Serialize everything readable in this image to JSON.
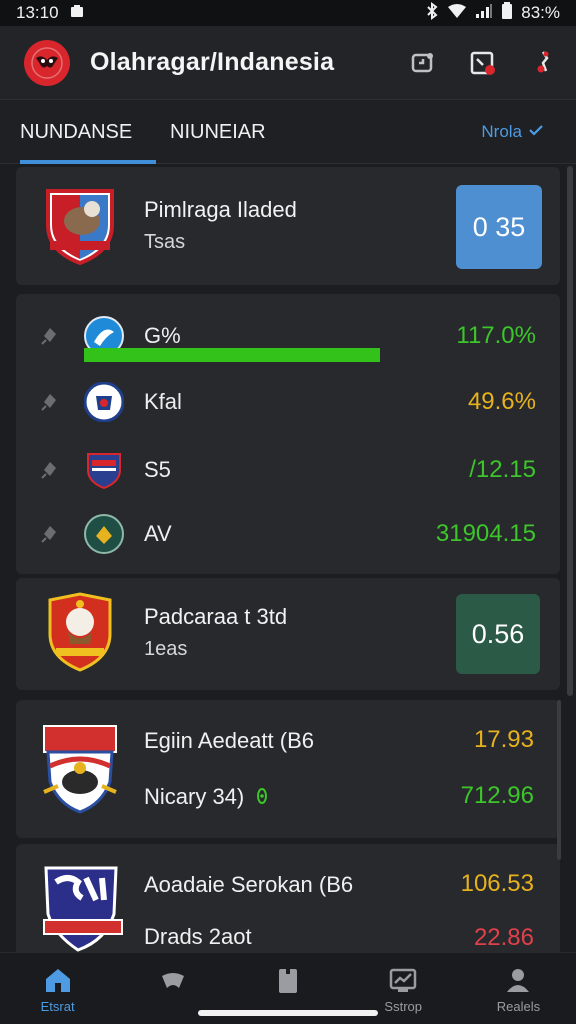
{
  "status_bar": {
    "time": "13:10",
    "battery": "83:%"
  },
  "app": {
    "title": "Olahragar/Indanesia"
  },
  "tabs": {
    "active": "NUNDANSE",
    "second": "NIUNEIAR",
    "filter_label": "Nrola"
  },
  "team_cards": [
    {
      "name": "Pimlraga Iladed",
      "sub": "Tsas",
      "score": "0 35",
      "score_color": "#4e8fd1"
    },
    {
      "name": "Padcaraa t 3td",
      "sub": "1eas",
      "score": "0.56",
      "score_color": "#2b5a46"
    }
  ],
  "stats": {
    "rows": [
      {
        "label": "G%",
        "value": "117.0%",
        "value_color": "#3cc62a",
        "progress": 1.0
      },
      {
        "label": "Kfal",
        "value": "49.6%",
        "value_color": "#e6b21e"
      },
      {
        "label": "S5",
        "value": "/12.15",
        "value_color": "#3cc62a"
      },
      {
        "label": "AV",
        "value": "31904.15",
        "value_color": "#3cc62a"
      }
    ]
  },
  "matches": [
    {
      "name": "Egiin Aedeatt (B6",
      "value": "17.93",
      "value_color": "#e6b21e",
      "sub_name": "Nicary 34)",
      "sub_value": "712.96",
      "sub_value_color": "#3cc62a"
    },
    {
      "name": "Aoadaie Serokan (B6",
      "value": "106.53",
      "value_color": "#e6b21e",
      "sub_name": "Drads 2aot",
      "sub_value": "22.86",
      "sub_value_color": "#e0404a"
    }
  ],
  "bottom_nav": [
    {
      "label": "Etsrat",
      "icon": "home-icon",
      "active": true
    },
    {
      "label": "",
      "icon": "ball-icon",
      "active": false
    },
    {
      "label": "",
      "icon": "clipboard-icon",
      "active": false
    },
    {
      "label": "Sstrop",
      "icon": "chart-icon",
      "active": false
    },
    {
      "label": "Realels",
      "icon": "profile-icon",
      "active": false
    }
  ],
  "colors": {
    "accent": "#3f8fd9",
    "background": "#1c1d20",
    "card": "#28292d"
  }
}
